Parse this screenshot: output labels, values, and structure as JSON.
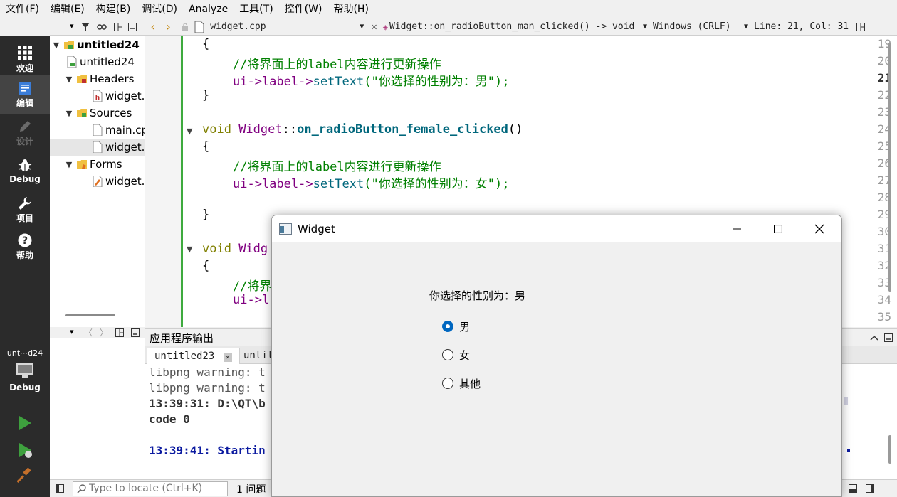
{
  "menu": [
    "文件(F)",
    "编辑(E)",
    "构建(B)",
    "调试(D)",
    "Analyze",
    "工具(T)",
    "控件(W)",
    "帮助(H)"
  ],
  "modes": [
    {
      "label": "欢迎",
      "icon": "grid-icon"
    },
    {
      "label": "编辑",
      "icon": "document-icon"
    },
    {
      "label": "设计",
      "icon": "pencil-icon"
    },
    {
      "label": "Debug",
      "icon": "bug-icon"
    },
    {
      "label": "项目",
      "icon": "wrench-icon"
    },
    {
      "label": "帮助",
      "icon": "help-icon"
    }
  ],
  "kit": {
    "project": "unt⋯d24",
    "mode": "Debug"
  },
  "tree": {
    "project": "untitled24",
    "pro_file": "untitled24",
    "headers": "Headers",
    "header_file": "widget.",
    "sources": "Sources",
    "main_file": "main.cp",
    "widget_cpp": "widget.",
    "forms": "Forms",
    "ui_file": "widget."
  },
  "editor": {
    "file": "widget.cpp",
    "symbol": "Widget::on_radioButton_man_clicked() -> void",
    "encoding": "Windows (CRLF)",
    "position": "Line: 21, Col: 31"
  },
  "code": {
    "line_numbers": [
      "19",
      "20",
      "21",
      "22",
      "23",
      "24",
      "25",
      "26",
      "27",
      "28",
      "29",
      "30",
      "31",
      "32",
      "33",
      "34",
      "35"
    ],
    "l19": "{",
    "l20_comment": "//将界面上的label内容进行更新操作",
    "l21_obj": "ui->label->",
    "l21_call": "setText",
    "l21_str": "(\"你选择的性别为：男\");",
    "l22": "}",
    "l24_kw": "void ",
    "l24_cls": "Widget",
    "l24_sep": "::",
    "l24_fn": "on_radioButton_female_clicked",
    "l24_args": "()",
    "l25": "{",
    "l26_comment": "//将界面上的label内容进行更新操作",
    "l27_obj": "ui->label->",
    "l27_call": "setText",
    "l27_str": "(\"你选择的性别为：女\");",
    "l29": "}",
    "l31_kw": "void ",
    "l31_cls": "Widg",
    "l32": "{",
    "l33_comment": "//将界",
    "l34_obj": "ui->l"
  },
  "output": {
    "title": "应用程序输出",
    "tabs": [
      "untitled23",
      "untit"
    ],
    "lines": [
      "libpng warning: t",
      "libpng warning: t",
      "13:39:31: D:\\QT\\b",
      "code 0",
      "",
      "13:39:41: Startin"
    ]
  },
  "status": {
    "locate_placeholder": "Type to locate (Ctrl+K)",
    "issues": "1 问题"
  },
  "widget_window": {
    "title": "Widget",
    "label": "你选择的性别为：男",
    "options": [
      "男",
      "女",
      "其他"
    ],
    "selected": "男"
  }
}
